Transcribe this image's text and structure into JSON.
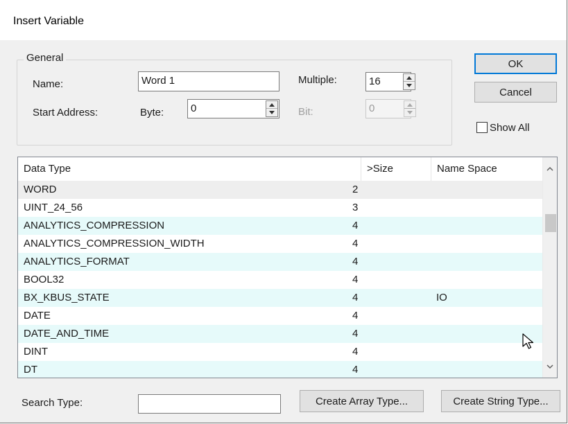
{
  "window": {
    "title": "Insert Variable"
  },
  "general": {
    "legend": "General",
    "name_label": "Name:",
    "name_value": "Word 1",
    "multiple_label": "Multiple:",
    "multiple_value": "16",
    "start_address_label": "Start Address:",
    "byte_label": "Byte:",
    "byte_value": "0",
    "bit_label": "Bit:",
    "bit_value": "0"
  },
  "buttons": {
    "ok": "OK",
    "cancel": "Cancel",
    "create_array": "Create Array Type...",
    "create_string": "Create String Type..."
  },
  "show_all": {
    "label": "Show All",
    "checked": false
  },
  "table": {
    "columns": [
      "Data Type",
      ">Size",
      "Name Space"
    ],
    "rows": [
      {
        "type": "WORD",
        "size": "2",
        "ns": ""
      },
      {
        "type": "UINT_24_56",
        "size": "3",
        "ns": ""
      },
      {
        "type": "ANALYTICS_COMPRESSION",
        "size": "4",
        "ns": ""
      },
      {
        "type": "ANALYTICS_COMPRESSION_WIDTH",
        "size": "4",
        "ns": ""
      },
      {
        "type": "ANALYTICS_FORMAT",
        "size": "4",
        "ns": ""
      },
      {
        "type": "BOOL32",
        "size": "4",
        "ns": ""
      },
      {
        "type": "BX_KBUS_STATE",
        "size": "4",
        "ns": "IO"
      },
      {
        "type": "DATE",
        "size": "4",
        "ns": ""
      },
      {
        "type": "DATE_AND_TIME",
        "size": "4",
        "ns": ""
      },
      {
        "type": "DINT",
        "size": "4",
        "ns": ""
      },
      {
        "type": "DT",
        "size": "4",
        "ns": ""
      }
    ]
  },
  "search": {
    "label": "Search Type:",
    "value": ""
  },
  "icons": {
    "scroll_up": "chevron-up-icon",
    "scroll_down": "chevron-down-icon",
    "cursor": "mouse-pointer-icon"
  },
  "colors": {
    "alt_row": "#e6fafa",
    "selected_row": "#eeeeee",
    "default_button_border": "#0078d7"
  }
}
